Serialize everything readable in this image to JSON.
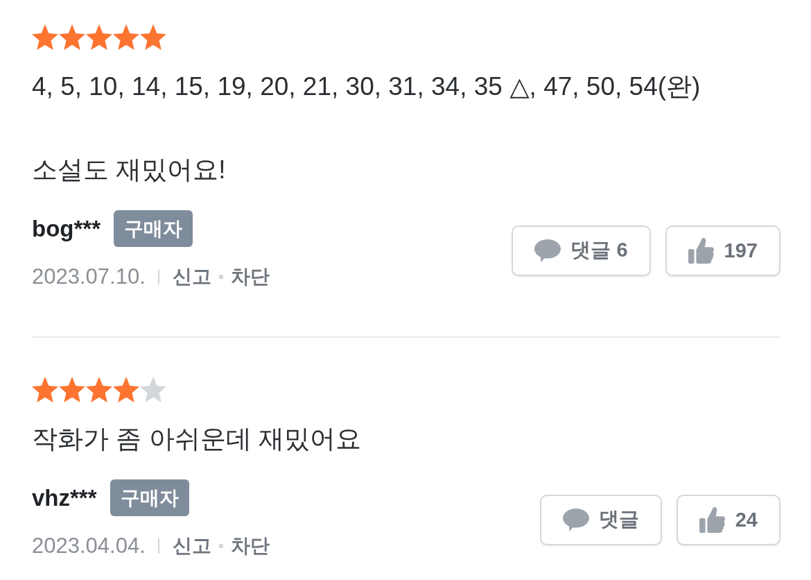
{
  "reviews": [
    {
      "stars": 5,
      "text": "4, 5, 10, 14, 15, 19, 20, 21, 30, 31, 34, 35 △, 47, 50, 54(완)\n\n소설도 재밌어요!",
      "user": "bog***",
      "badge": "구매자",
      "date": "2023.07.10.",
      "actions": [
        "신고",
        "차단"
      ],
      "comments": {
        "label": "댓글",
        "count": "6"
      },
      "likes": {
        "count": "197"
      }
    },
    {
      "stars": 4,
      "text": "작화가 좀 아쉬운데 재밌어요",
      "user": "vhz***",
      "badge": "구매자",
      "date": "2023.04.04.",
      "actions": [
        "신고",
        "차단"
      ],
      "comments": {
        "label": "댓글"
      },
      "likes": {
        "count": "24"
      }
    }
  ]
}
